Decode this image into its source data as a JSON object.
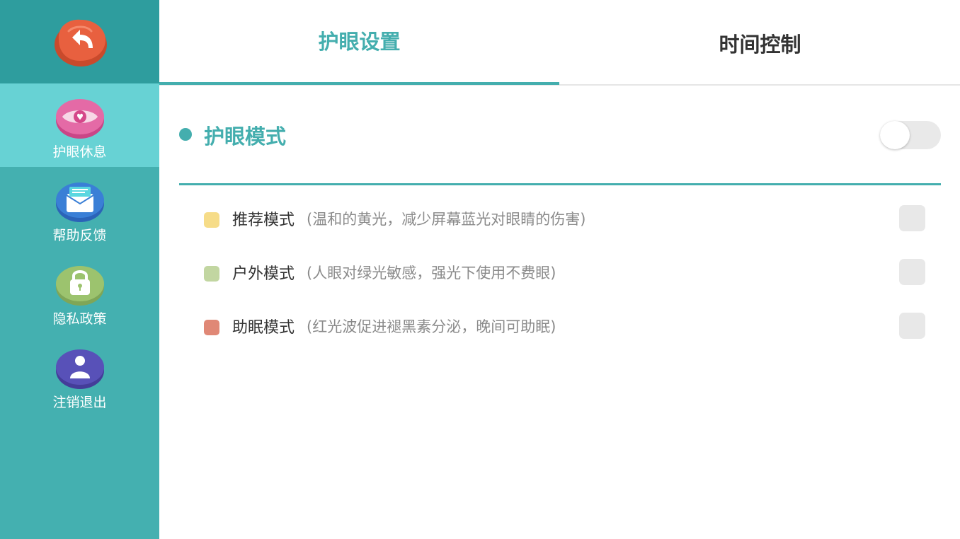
{
  "sidebar": {
    "back_icon": "back-arrow-icon",
    "items": [
      {
        "label": "护眼休息",
        "icon": "eye-heart-icon",
        "color": "#e46aa6",
        "active": true
      },
      {
        "label": "帮助反馈",
        "icon": "envelope-icon",
        "color": "#3a7fd6",
        "active": false
      },
      {
        "label": "隐私政策",
        "icon": "lock-icon",
        "color": "#9cc36e",
        "active": false
      },
      {
        "label": "注销退出",
        "icon": "user-icon",
        "color": "#5851b8",
        "active": false
      }
    ]
  },
  "tabs": [
    {
      "label": "护眼设置",
      "active": true
    },
    {
      "label": "时间控制",
      "active": false
    }
  ],
  "section": {
    "title": "护眼模式",
    "toggle_on": false
  },
  "modes": [
    {
      "name": "推荐模式",
      "desc": "(温和的黄光，减少屏幕蓝光对眼睛的伤害)",
      "color": "#f6dc88",
      "checked": false
    },
    {
      "name": "户外模式",
      "desc": "(人眼对绿光敏感，强光下使用不费眼)",
      "color": "#c2d6a1",
      "checked": false
    },
    {
      "name": "助眠模式",
      "desc": "(红光波促进褪黑素分泌，晚间可助眠)",
      "color": "#e08876",
      "checked": false
    }
  ],
  "colors": {
    "accent": "#44aeae",
    "sidebar_bg": "#44b0b0",
    "sidebar_active": "#67d2d4"
  }
}
